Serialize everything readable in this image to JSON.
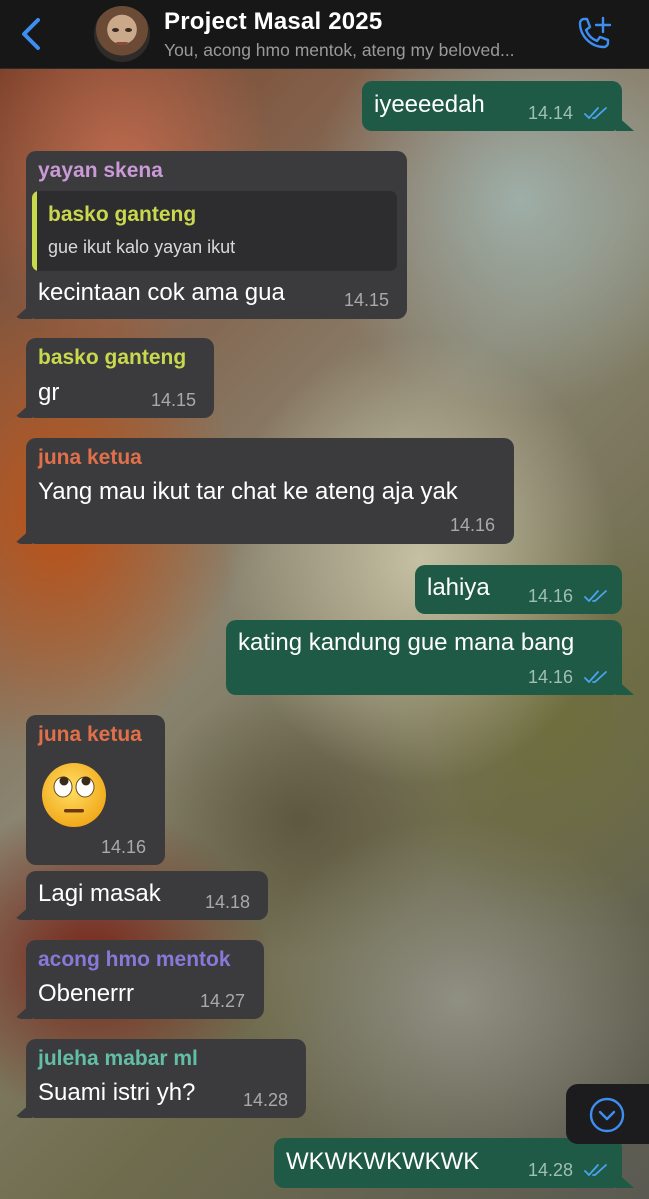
{
  "header": {
    "title": "Project Masal 2025",
    "subtitle": "You, acong hmo mentok, ateng my beloved..."
  },
  "colors": {
    "accent": "#3d8ef0",
    "incoming_bubble": "#3b3b3d",
    "outgoing_bubble": "#1f5a47",
    "name_yayan": "#c99ad6",
    "name_basko": "#c9d94e",
    "name_juna": "#e0704a",
    "name_acong": "#8a78d8",
    "name_juleha": "#62bfa5"
  },
  "messages": [
    {
      "direction": "out",
      "text": "iyeeeedah",
      "time": "14.14",
      "read_icon": "double-check-icon"
    },
    {
      "direction": "in",
      "sender": "yayan skena",
      "quote": {
        "sender": "basko ganteng",
        "text": "gue ikut kalo yayan ikut"
      },
      "text": "kecintaan cok ama gua",
      "time": "14.15"
    },
    {
      "direction": "in",
      "sender": "basko ganteng",
      "text": "gr",
      "time": "14.15"
    },
    {
      "direction": "in",
      "sender": "juna ketua",
      "text": "Yang mau ikut tar chat ke ateng aja yak",
      "time": "14.16"
    },
    {
      "direction": "out",
      "text": "lahiya",
      "time": "14.16",
      "read_icon": "double-check-icon"
    },
    {
      "direction": "out",
      "text": "kating kandung gue mana bang",
      "time": "14.16",
      "read_icon": "double-check-icon"
    },
    {
      "direction": "in",
      "sender": "juna ketua",
      "emoji": "face-with-rolling-eyes-icon",
      "time": "14.16"
    },
    {
      "direction": "in",
      "text": "Lagi masak",
      "time": "14.18"
    },
    {
      "direction": "in",
      "sender": "acong hmo mentok",
      "text": "Obenerrr",
      "time": "14.27"
    },
    {
      "direction": "in",
      "sender": "juleha mabar ml",
      "text": "Suami istri yh?",
      "time": "14.28"
    },
    {
      "direction": "out",
      "text": "WKWKWKWKWK",
      "time": "14.28",
      "read_icon": "double-check-icon"
    }
  ]
}
